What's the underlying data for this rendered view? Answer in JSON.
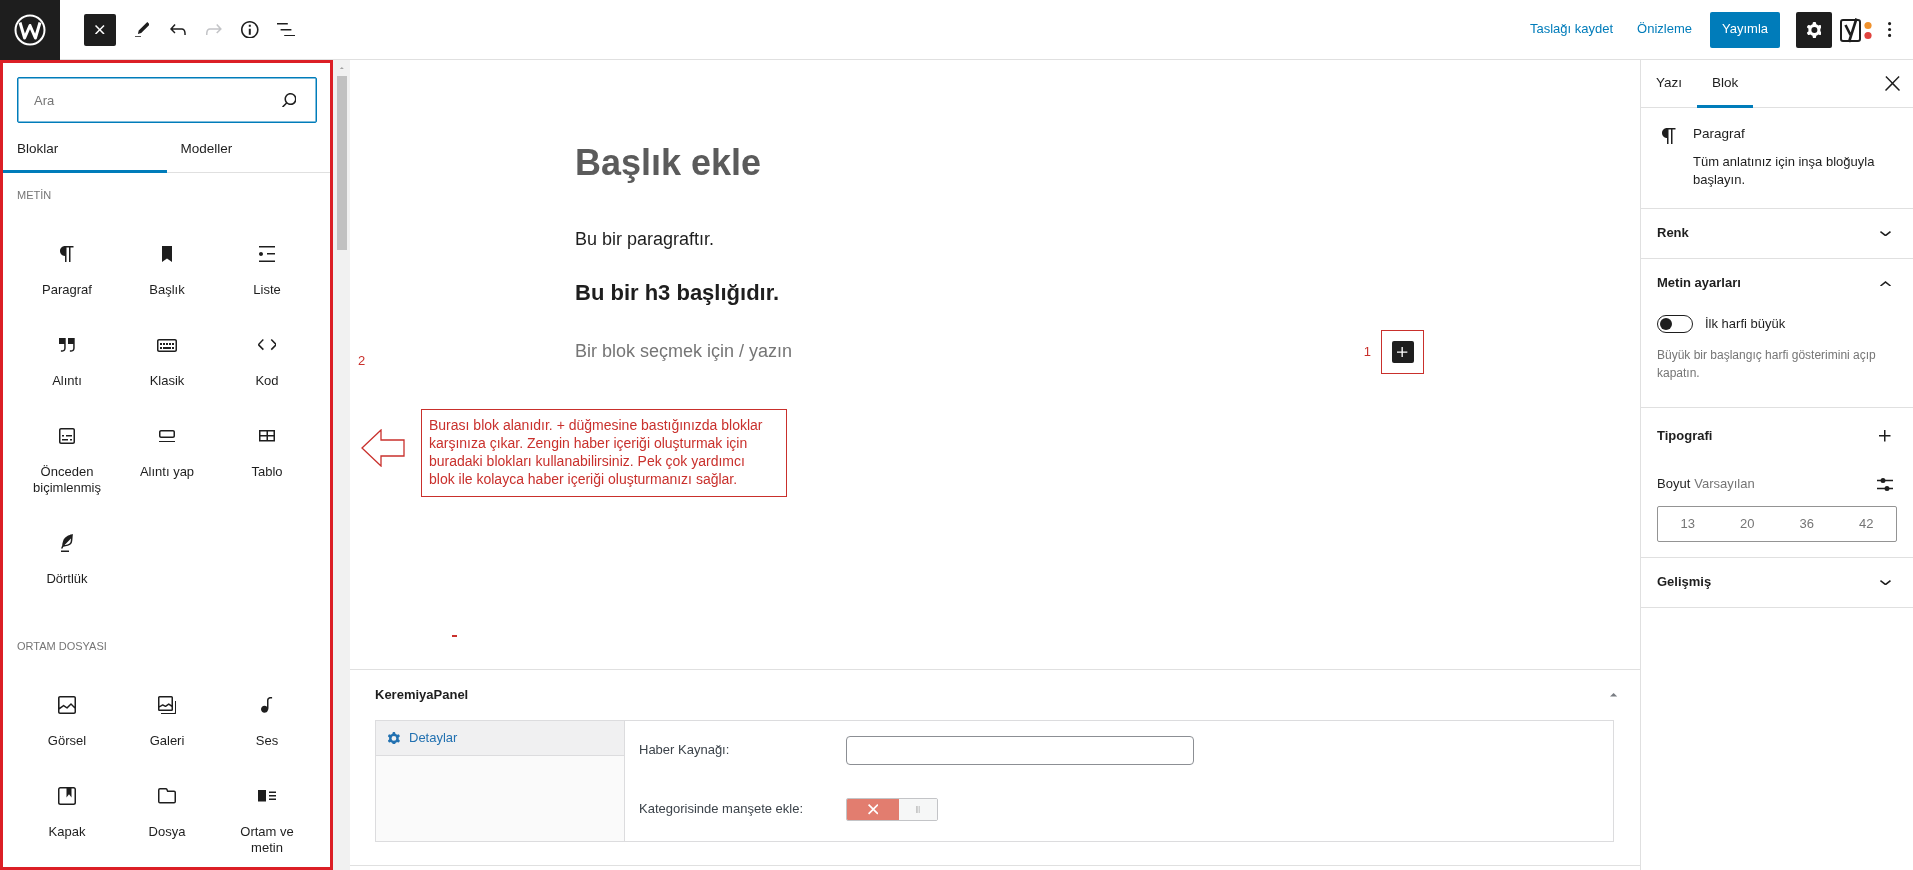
{
  "top_bar": {
    "tools": [
      {
        "kind": "inserter_close",
        "disabled": false
      },
      {
        "kind": "edit",
        "disabled": false
      },
      {
        "kind": "undo",
        "disabled": false
      },
      {
        "kind": "redo",
        "disabled": true
      },
      {
        "kind": "info",
        "disabled": false
      },
      {
        "kind": "list_view",
        "disabled": false
      }
    ],
    "save_draft": "Taslağı kaydet",
    "preview": "Önizleme",
    "publish": "Yayımla",
    "settings_pressed": true
  },
  "inserter": {
    "search": {
      "placeholder": "Ara"
    },
    "tabs": [
      {
        "label": "Bloklar",
        "selected": true
      },
      {
        "label": "Modeller",
        "selected": false
      }
    ],
    "categories": [
      {
        "title": "METİN",
        "blocks": [
          {
            "kind": "paragraph",
            "label": "Paragraf"
          },
          {
            "kind": "heading",
            "label": "Başlık"
          },
          {
            "kind": "list",
            "label": "Liste"
          },
          {
            "kind": "quote",
            "label": "Alıntı"
          },
          {
            "kind": "classic",
            "label": "Klasik"
          },
          {
            "kind": "code",
            "label": "Kod"
          },
          {
            "kind": "preformatted",
            "label": "Önceden biçimlenmiş"
          },
          {
            "kind": "pullquote",
            "label": "Alıntı yap"
          },
          {
            "kind": "table",
            "label": "Tablo"
          },
          {
            "kind": "verse",
            "label": "Dörtlük"
          }
        ]
      },
      {
        "title": "ORTAM DOSYASI",
        "blocks": [
          {
            "kind": "image",
            "label": "Görsel"
          },
          {
            "kind": "gallery",
            "label": "Galeri"
          },
          {
            "kind": "audio",
            "label": "Ses"
          },
          {
            "kind": "cover",
            "label": "Kapak"
          },
          {
            "kind": "file",
            "label": "Dosya"
          },
          {
            "kind": "media_text",
            "label": "Ortam ve metin"
          }
        ]
      }
    ]
  },
  "editor": {
    "title_placeholder": "Başlık ekle",
    "blocks": [
      {
        "kind": "paragraph",
        "text": "Bu bir paragraftır."
      },
      {
        "kind": "heading",
        "text": "Bu bir h3 başlığıdır."
      },
      {
        "kind": "appender",
        "placeholder": "Bir blok seçmek için / yazın"
      }
    ],
    "annotations": {
      "plus_button_label": "1",
      "block_area_label": "2",
      "block_area_note": "Burası blok alanıdır. + düğmesine bastığınızda bloklar karşınıza çıkar. Zengin haber içeriği oluşturmak için buradaki blokları kullanabilirsiniz. Pek çok yardımcı blok ile kolayca haber içeriği oluşturmanızı sağlar."
    }
  },
  "meta_box": {
    "title": "KeremiyaPanel",
    "expanded": true,
    "tabs": [
      {
        "label": "Detaylar",
        "selected": true
      }
    ],
    "fields": [
      {
        "kind": "text",
        "label": "Haber Kaynağı:"
      },
      {
        "kind": "switch",
        "label": "Kategorisinde manşete ekle:",
        "on": false
      }
    ]
  },
  "sidebar": {
    "tabs": [
      {
        "label": "Yazı",
        "selected": false
      },
      {
        "label": "Blok",
        "selected": true
      }
    ],
    "block_card": {
      "title": "Paragraf",
      "description": "Tüm anlatınız için inşa bloğuyla başlayın."
    },
    "panels": [
      {
        "kind": "collapsible",
        "title": "Renk",
        "expanded": false
      },
      {
        "kind": "collapsible",
        "title": "Metin ayarları",
        "expanded": true,
        "controls": [
          {
            "kind": "toggle",
            "label": "İlk harfi büyük",
            "on": false,
            "help": "Büyük bir başlangıç harfi gösterimini açıp kapatın."
          }
        ]
      },
      {
        "kind": "tools",
        "title": "Tipografi",
        "controls": [
          {
            "kind": "font_size",
            "label": "Boyut",
            "value": "Varsayılan",
            "options": [
              {
                "label": "13",
                "selected": false
              },
              {
                "label": "20",
                "selected": false
              },
              {
                "label": "36",
                "selected": false
              },
              {
                "label": "42",
                "selected": false
              }
            ]
          }
        ]
      },
      {
        "kind": "collapsible",
        "title": "Gelişmiş",
        "expanded": false
      }
    ]
  }
}
